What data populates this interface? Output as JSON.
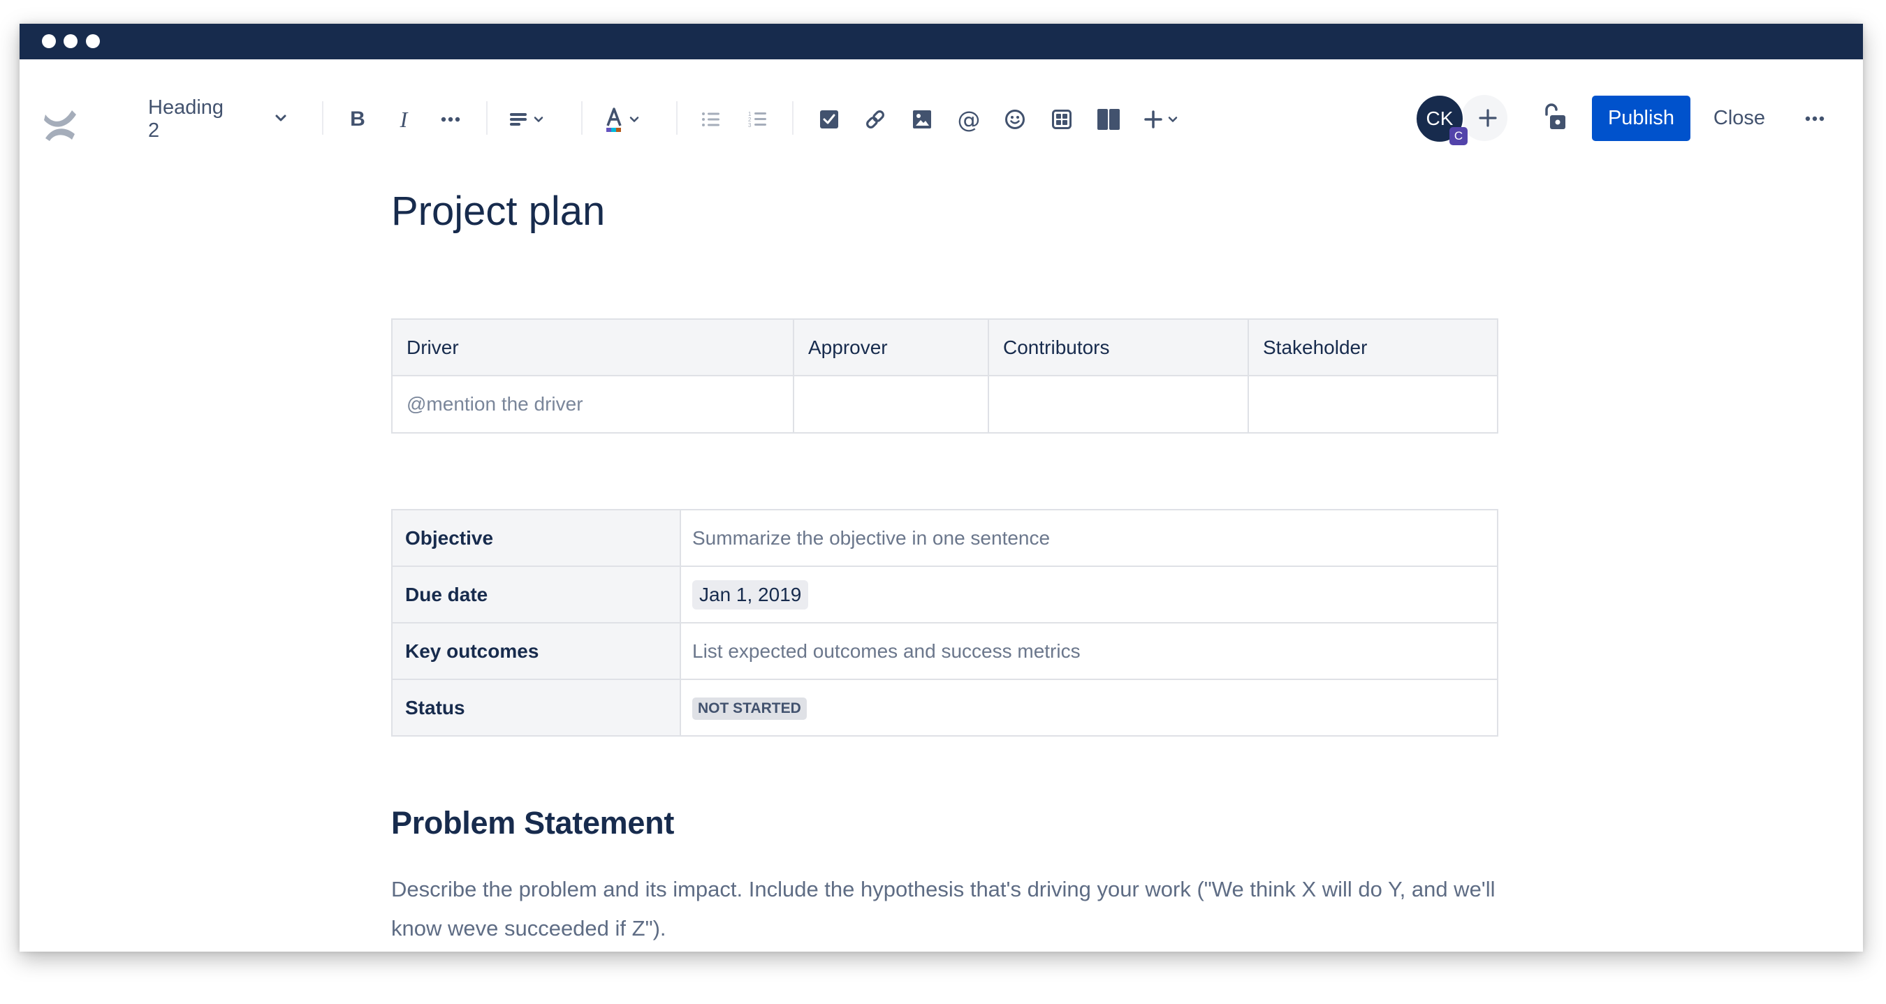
{
  "window": {
    "titlebar_dots": 3,
    "colors": {
      "titlebar": "#172b4d",
      "accent": "#0052cc",
      "badge": "#5243aa"
    }
  },
  "toolbar": {
    "logo": "confluence-logo",
    "text_style": "Heading 2",
    "icons": {
      "bold": "B",
      "italic": "I",
      "more_formatting": "more-formatting-icon",
      "alignment": "align-left-icon",
      "text_color": "text-color-icon",
      "bullet_list": "bullet-list-icon",
      "numbered_list": "numbered-list-icon",
      "action_item": "checkbox-icon",
      "link": "link-icon",
      "image": "image-icon",
      "mention": "@",
      "emoji": "emoji-icon",
      "table": "table-icon",
      "layouts": "columns-icon",
      "insert": "plus-icon"
    },
    "collaborator": {
      "initials": "CK",
      "badge": "C"
    },
    "invite": "+",
    "restrictions": "unlock-icon",
    "publish_label": "Publish",
    "close_label": "Close",
    "more": "more-icon"
  },
  "page": {
    "title": "Project plan",
    "roles_table": {
      "headers": [
        "Driver",
        "Approver",
        "Contributors",
        "Stakeholder"
      ],
      "rows": [
        [
          "@mention the driver",
          "",
          "",
          ""
        ]
      ]
    },
    "details_table": {
      "rows": [
        {
          "label": "Objective",
          "value": "Summarize the objective in one sentence",
          "kind": "placeholder"
        },
        {
          "label": "Due date",
          "value": "Jan 1, 2019",
          "kind": "date"
        },
        {
          "label": "Key outcomes",
          "value": "List expected outcomes and success metrics",
          "kind": "placeholder"
        },
        {
          "label": "Status",
          "value": "NOT STARTED",
          "kind": "status"
        }
      ]
    },
    "section_heading": "Problem Statement",
    "section_text": "Describe the problem and its impact. Include the hypothesis that's driving your work (\"We think X will do Y, and we'll know weve succeeded if Z\")."
  }
}
